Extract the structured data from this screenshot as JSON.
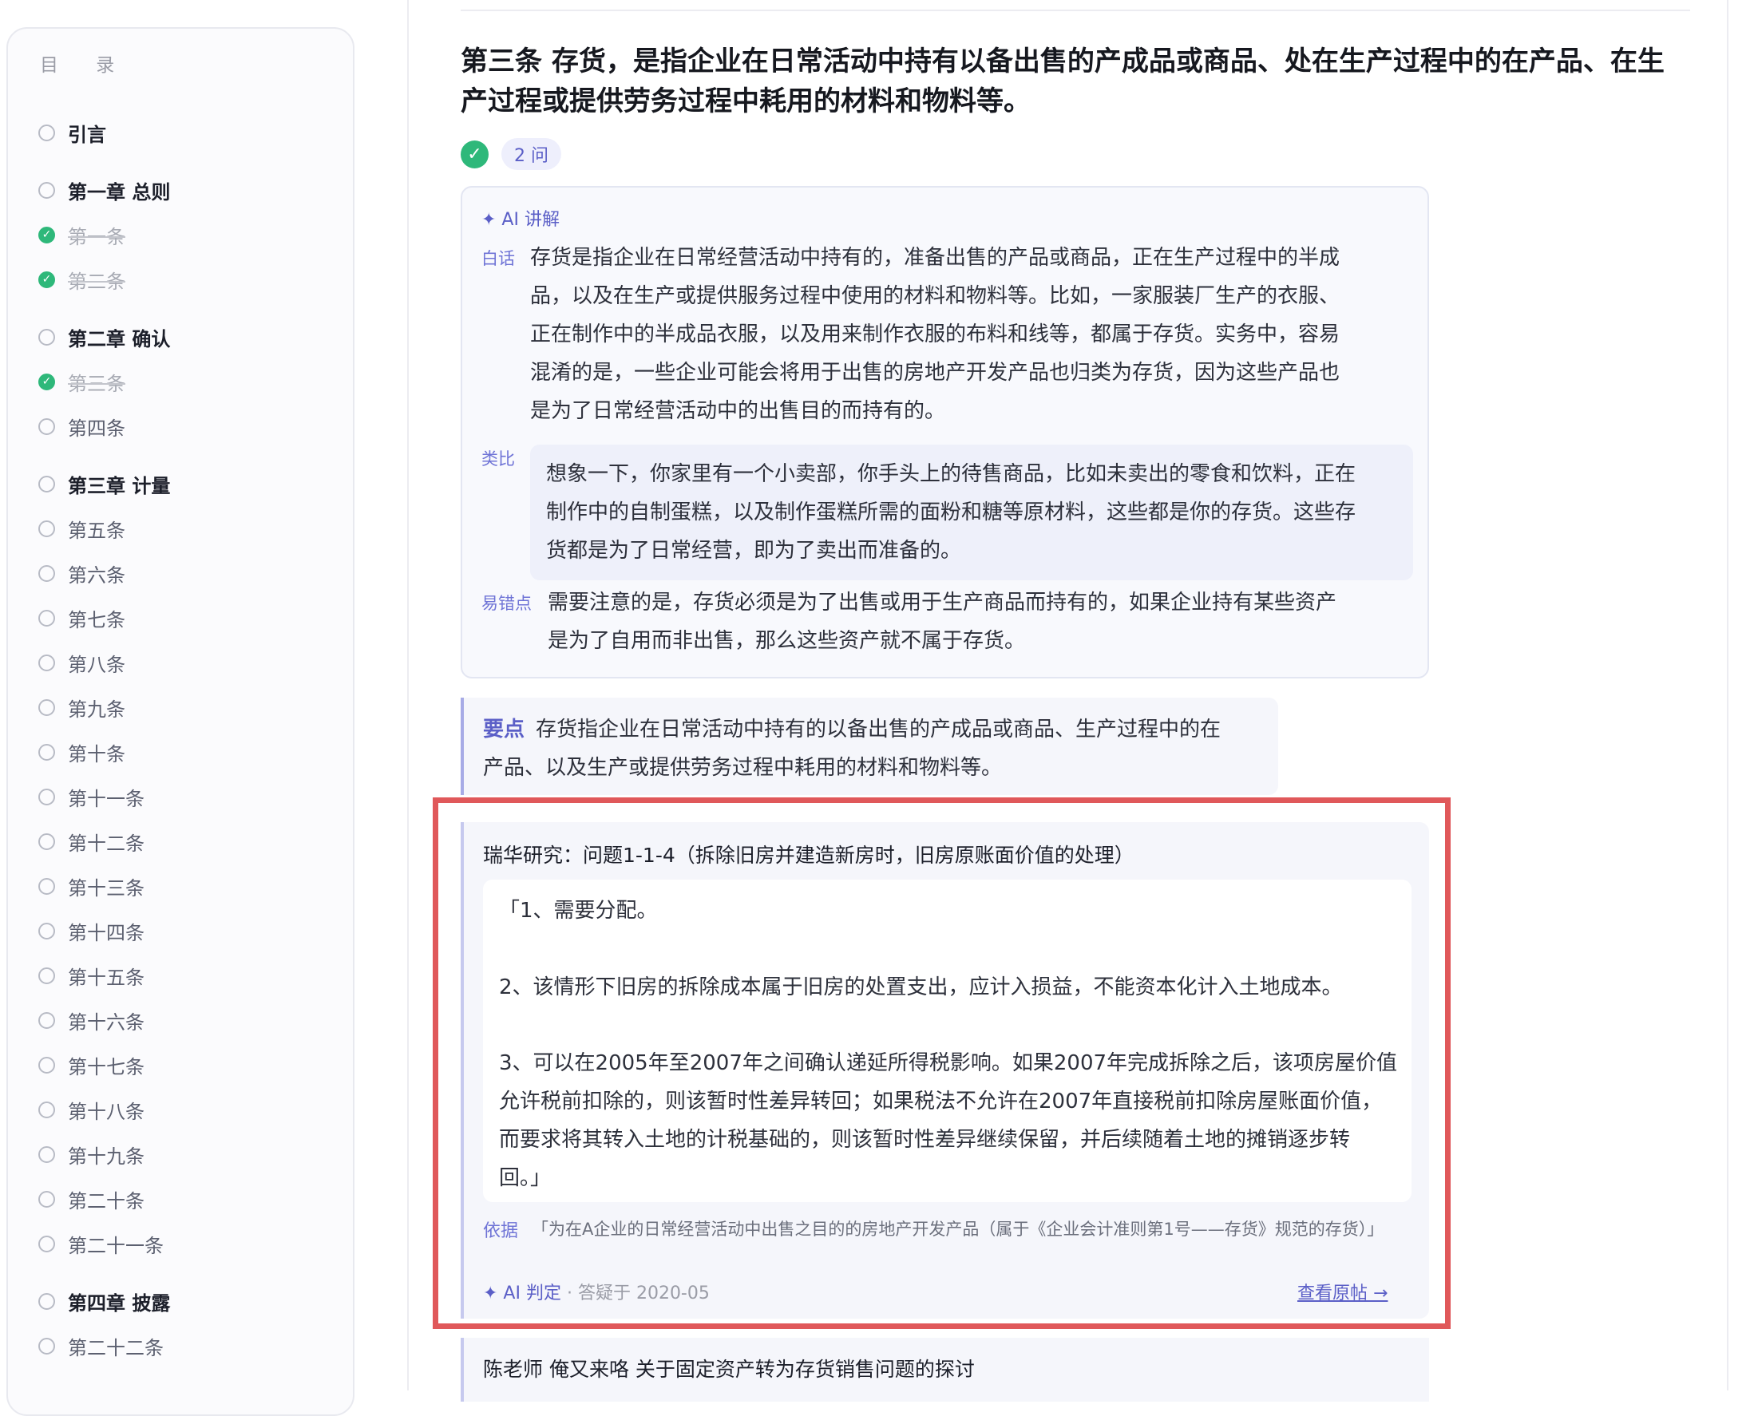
{
  "toc": {
    "title": "目 录",
    "items": [
      {
        "label": "引言",
        "type": "chapter",
        "done": false
      },
      {
        "label": "第一章 总则",
        "type": "chapter",
        "done": false
      },
      {
        "label": "第一条",
        "type": "article",
        "done": true
      },
      {
        "label": "第二条",
        "type": "article",
        "done": true
      },
      {
        "label": "第二章 确认",
        "type": "chapter",
        "done": false
      },
      {
        "label": "第三条",
        "type": "article",
        "done": true
      },
      {
        "label": "第四条",
        "type": "article",
        "done": false
      },
      {
        "label": "第三章 计量",
        "type": "chapter",
        "done": false
      },
      {
        "label": "第五条",
        "type": "article",
        "done": false
      },
      {
        "label": "第六条",
        "type": "article",
        "done": false
      },
      {
        "label": "第七条",
        "type": "article",
        "done": false
      },
      {
        "label": "第八条",
        "type": "article",
        "done": false
      },
      {
        "label": "第九条",
        "type": "article",
        "done": false
      },
      {
        "label": "第十条",
        "type": "article",
        "done": false
      },
      {
        "label": "第十一条",
        "type": "article",
        "done": false
      },
      {
        "label": "第十二条",
        "type": "article",
        "done": false
      },
      {
        "label": "第十三条",
        "type": "article",
        "done": false
      },
      {
        "label": "第十四条",
        "type": "article",
        "done": false
      },
      {
        "label": "第十五条",
        "type": "article",
        "done": false
      },
      {
        "label": "第十六条",
        "type": "article",
        "done": false
      },
      {
        "label": "第十七条",
        "type": "article",
        "done": false
      },
      {
        "label": "第十八条",
        "type": "article",
        "done": false
      },
      {
        "label": "第十九条",
        "type": "article",
        "done": false
      },
      {
        "label": "第二十条",
        "type": "article",
        "done": false
      },
      {
        "label": "第二十一条",
        "type": "article",
        "done": false
      },
      {
        "label": "第四章 披露",
        "type": "chapter",
        "done": false
      },
      {
        "label": "第二十二条",
        "type": "article",
        "done": false
      }
    ]
  },
  "article": {
    "title": "第三条 存货，是指企业在日常活动中持有以备出售的产成品或商品、处在生产过程中的在产品、在生产过程或提供劳务过程中耗用的材料和物料等。",
    "check_icon": "✓",
    "question_count": "2 问"
  },
  "ai_explain": {
    "header": "✦ AI 讲解",
    "plain_label": "白话",
    "plain_lines": [
      "存货是指企业在日常经营活动中持有的，准备出售的产品或商品，正在生产过程中的半成",
      "品，以及在生产或提供服务过程中使用的材料和物料等。比如，一家服装厂生产的衣服、",
      "正在制作中的半成品衣服，以及用来制作衣服的布料和线等，都属于存货。实务中，容易",
      "混淆的是，一些企业可能会将用于出售的房地产开发产品也归类为存货，因为这些产品也",
      "是为了日常经营活动中的出售目的而持有的。"
    ],
    "analogy_label": "类比",
    "analogy_lines": [
      "想象一下，你家里有一个小卖部，你手头上的待售商品，比如未卖出的零食和饮料，正在",
      "制作中的自制蛋糕，以及制作蛋糕所需的面粉和糖等原材料，这些都是你的存货。这些存",
      "货都是为了日常经营，即为了卖出而准备的。"
    ],
    "pitfall_label": "易错点",
    "pitfall_lines": [
      "需要注意的是，存货必须是为了出售或用于生产商品而持有的，如果企业持有某些资产",
      "是为了自用而非出售，那么这些资产就不属于存货。"
    ]
  },
  "key_point": {
    "label": "要点",
    "line1": "存货指企业在日常活动中持有的以备出售的产成品或商品、生产过程中的在",
    "line2": "产品、以及生产或提供劳务过程中耗用的材料和物料等。"
  },
  "qa": {
    "title": "瑞华研究：问题1-1-4（拆除旧房并建造新房时，旧房原账面价值的处理）",
    "quote_lines": [
      "「1、需要分配。",
      "2、该情形下旧房的拆除成本属于旧房的处置支出，应计入损益，不能资本化计入土地成本。",
      "3、可以在2005年至2007年之间确认递延所得税影响。如果2007年完成拆除之后，该项房屋价值",
      "允许税前扣除的，则该暂时性差异转回；如果税法不允许在2007年直接税前扣除房屋账面价值，",
      "而要求将其转入土地的计税基础的，则该暂时性差异继续保留，并后续随着土地的摊销逐步转",
      "回。」"
    ],
    "basis_label": "依据",
    "basis_text": "「为在A企业的日常经营活动中出售之目的的房地产开发产品（属于《企业会计准则第1号——存货》规范的存货）」",
    "ai_tag": "✦ AI 判定",
    "date": "· 答疑于 2020-05",
    "link": "查看原帖 →"
  },
  "next_qa": {
    "title": "陈老师 俺又来咯 关于固定资产转为存货销售问题的探讨"
  },
  "colors": {
    "accent": "#5b5fc7",
    "success": "#2eb87a",
    "highlight": "#e0585a"
  }
}
